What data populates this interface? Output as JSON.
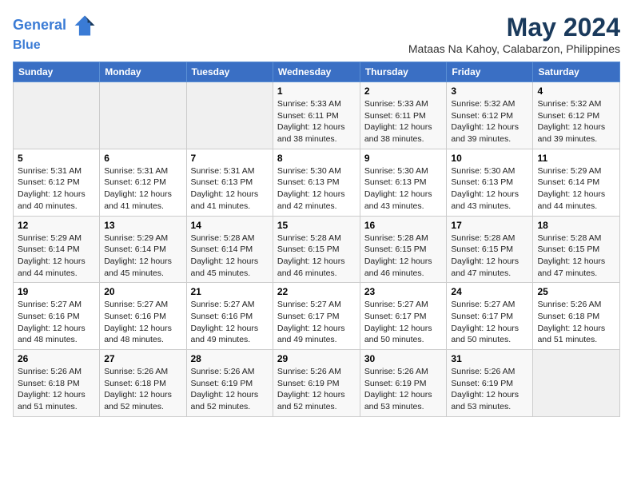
{
  "header": {
    "logo_line1": "General",
    "logo_line2": "Blue",
    "month_year": "May 2024",
    "location": "Mataas Na Kahoy, Calabarzon, Philippines"
  },
  "weekdays": [
    "Sunday",
    "Monday",
    "Tuesday",
    "Wednesday",
    "Thursday",
    "Friday",
    "Saturday"
  ],
  "weeks": [
    [
      {
        "day": "",
        "sunrise": "",
        "sunset": "",
        "daylight": ""
      },
      {
        "day": "",
        "sunrise": "",
        "sunset": "",
        "daylight": ""
      },
      {
        "day": "",
        "sunrise": "",
        "sunset": "",
        "daylight": ""
      },
      {
        "day": "1",
        "sunrise": "Sunrise: 5:33 AM",
        "sunset": "Sunset: 6:11 PM",
        "daylight": "Daylight: 12 hours and 38 minutes."
      },
      {
        "day": "2",
        "sunrise": "Sunrise: 5:33 AM",
        "sunset": "Sunset: 6:11 PM",
        "daylight": "Daylight: 12 hours and 38 minutes."
      },
      {
        "day": "3",
        "sunrise": "Sunrise: 5:32 AM",
        "sunset": "Sunset: 6:12 PM",
        "daylight": "Daylight: 12 hours and 39 minutes."
      },
      {
        "day": "4",
        "sunrise": "Sunrise: 5:32 AM",
        "sunset": "Sunset: 6:12 PM",
        "daylight": "Daylight: 12 hours and 39 minutes."
      }
    ],
    [
      {
        "day": "5",
        "sunrise": "Sunrise: 5:31 AM",
        "sunset": "Sunset: 6:12 PM",
        "daylight": "Daylight: 12 hours and 40 minutes."
      },
      {
        "day": "6",
        "sunrise": "Sunrise: 5:31 AM",
        "sunset": "Sunset: 6:12 PM",
        "daylight": "Daylight: 12 hours and 41 minutes."
      },
      {
        "day": "7",
        "sunrise": "Sunrise: 5:31 AM",
        "sunset": "Sunset: 6:13 PM",
        "daylight": "Daylight: 12 hours and 41 minutes."
      },
      {
        "day": "8",
        "sunrise": "Sunrise: 5:30 AM",
        "sunset": "Sunset: 6:13 PM",
        "daylight": "Daylight: 12 hours and 42 minutes."
      },
      {
        "day": "9",
        "sunrise": "Sunrise: 5:30 AM",
        "sunset": "Sunset: 6:13 PM",
        "daylight": "Daylight: 12 hours and 43 minutes."
      },
      {
        "day": "10",
        "sunrise": "Sunrise: 5:30 AM",
        "sunset": "Sunset: 6:13 PM",
        "daylight": "Daylight: 12 hours and 43 minutes."
      },
      {
        "day": "11",
        "sunrise": "Sunrise: 5:29 AM",
        "sunset": "Sunset: 6:14 PM",
        "daylight": "Daylight: 12 hours and 44 minutes."
      }
    ],
    [
      {
        "day": "12",
        "sunrise": "Sunrise: 5:29 AM",
        "sunset": "Sunset: 6:14 PM",
        "daylight": "Daylight: 12 hours and 44 minutes."
      },
      {
        "day": "13",
        "sunrise": "Sunrise: 5:29 AM",
        "sunset": "Sunset: 6:14 PM",
        "daylight": "Daylight: 12 hours and 45 minutes."
      },
      {
        "day": "14",
        "sunrise": "Sunrise: 5:28 AM",
        "sunset": "Sunset: 6:14 PM",
        "daylight": "Daylight: 12 hours and 45 minutes."
      },
      {
        "day": "15",
        "sunrise": "Sunrise: 5:28 AM",
        "sunset": "Sunset: 6:15 PM",
        "daylight": "Daylight: 12 hours and 46 minutes."
      },
      {
        "day": "16",
        "sunrise": "Sunrise: 5:28 AM",
        "sunset": "Sunset: 6:15 PM",
        "daylight": "Daylight: 12 hours and 46 minutes."
      },
      {
        "day": "17",
        "sunrise": "Sunrise: 5:28 AM",
        "sunset": "Sunset: 6:15 PM",
        "daylight": "Daylight: 12 hours and 47 minutes."
      },
      {
        "day": "18",
        "sunrise": "Sunrise: 5:28 AM",
        "sunset": "Sunset: 6:15 PM",
        "daylight": "Daylight: 12 hours and 47 minutes."
      }
    ],
    [
      {
        "day": "19",
        "sunrise": "Sunrise: 5:27 AM",
        "sunset": "Sunset: 6:16 PM",
        "daylight": "Daylight: 12 hours and 48 minutes."
      },
      {
        "day": "20",
        "sunrise": "Sunrise: 5:27 AM",
        "sunset": "Sunset: 6:16 PM",
        "daylight": "Daylight: 12 hours and 48 minutes."
      },
      {
        "day": "21",
        "sunrise": "Sunrise: 5:27 AM",
        "sunset": "Sunset: 6:16 PM",
        "daylight": "Daylight: 12 hours and 49 minutes."
      },
      {
        "day": "22",
        "sunrise": "Sunrise: 5:27 AM",
        "sunset": "Sunset: 6:17 PM",
        "daylight": "Daylight: 12 hours and 49 minutes."
      },
      {
        "day": "23",
        "sunrise": "Sunrise: 5:27 AM",
        "sunset": "Sunset: 6:17 PM",
        "daylight": "Daylight: 12 hours and 50 minutes."
      },
      {
        "day": "24",
        "sunrise": "Sunrise: 5:27 AM",
        "sunset": "Sunset: 6:17 PM",
        "daylight": "Daylight: 12 hours and 50 minutes."
      },
      {
        "day": "25",
        "sunrise": "Sunrise: 5:26 AM",
        "sunset": "Sunset: 6:18 PM",
        "daylight": "Daylight: 12 hours and 51 minutes."
      }
    ],
    [
      {
        "day": "26",
        "sunrise": "Sunrise: 5:26 AM",
        "sunset": "Sunset: 6:18 PM",
        "daylight": "Daylight: 12 hours and 51 minutes."
      },
      {
        "day": "27",
        "sunrise": "Sunrise: 5:26 AM",
        "sunset": "Sunset: 6:18 PM",
        "daylight": "Daylight: 12 hours and 52 minutes."
      },
      {
        "day": "28",
        "sunrise": "Sunrise: 5:26 AM",
        "sunset": "Sunset: 6:19 PM",
        "daylight": "Daylight: 12 hours and 52 minutes."
      },
      {
        "day": "29",
        "sunrise": "Sunrise: 5:26 AM",
        "sunset": "Sunset: 6:19 PM",
        "daylight": "Daylight: 12 hours and 52 minutes."
      },
      {
        "day": "30",
        "sunrise": "Sunrise: 5:26 AM",
        "sunset": "Sunset: 6:19 PM",
        "daylight": "Daylight: 12 hours and 53 minutes."
      },
      {
        "day": "31",
        "sunrise": "Sunrise: 5:26 AM",
        "sunset": "Sunset: 6:19 PM",
        "daylight": "Daylight: 12 hours and 53 minutes."
      },
      {
        "day": "",
        "sunrise": "",
        "sunset": "",
        "daylight": ""
      }
    ]
  ]
}
